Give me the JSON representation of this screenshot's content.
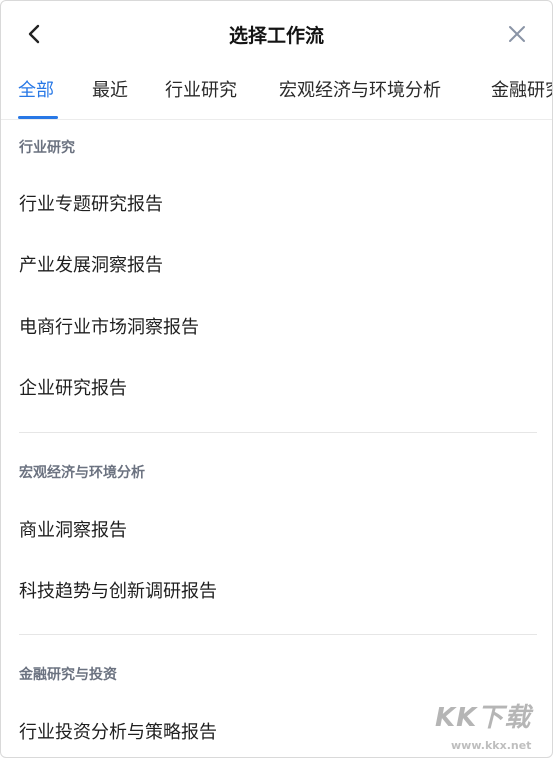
{
  "header": {
    "title": "选择工作流",
    "back_icon": "chevron-left-icon",
    "close_icon": "close-icon"
  },
  "tabs": [
    {
      "label": "全部",
      "active": true
    },
    {
      "label": "最近",
      "active": false
    },
    {
      "label": "行业研究",
      "active": false
    },
    {
      "label": "宏观经济与环境分析",
      "active": false
    },
    {
      "label": "金融研究与投资",
      "active": false
    }
  ],
  "sections": [
    {
      "title": "行业研究",
      "items": [
        "行业专题研究报告",
        "产业发展洞察报告",
        "电商行业市场洞察报告",
        "企业研究报告"
      ]
    },
    {
      "title": "宏观经济与环境分析",
      "items": [
        "商业洞察报告",
        "科技趋势与创新调研报告"
      ]
    },
    {
      "title": "金融研究与投资",
      "items": [
        "行业投资分析与策略报告"
      ]
    }
  ],
  "watermark": {
    "logo": "KK下载",
    "url": "www.kkx.net"
  },
  "colors": {
    "accent": "#2878e6",
    "section_title": "#6b7280",
    "text": "#1f1f1f",
    "divider": "#e6e6e6"
  }
}
